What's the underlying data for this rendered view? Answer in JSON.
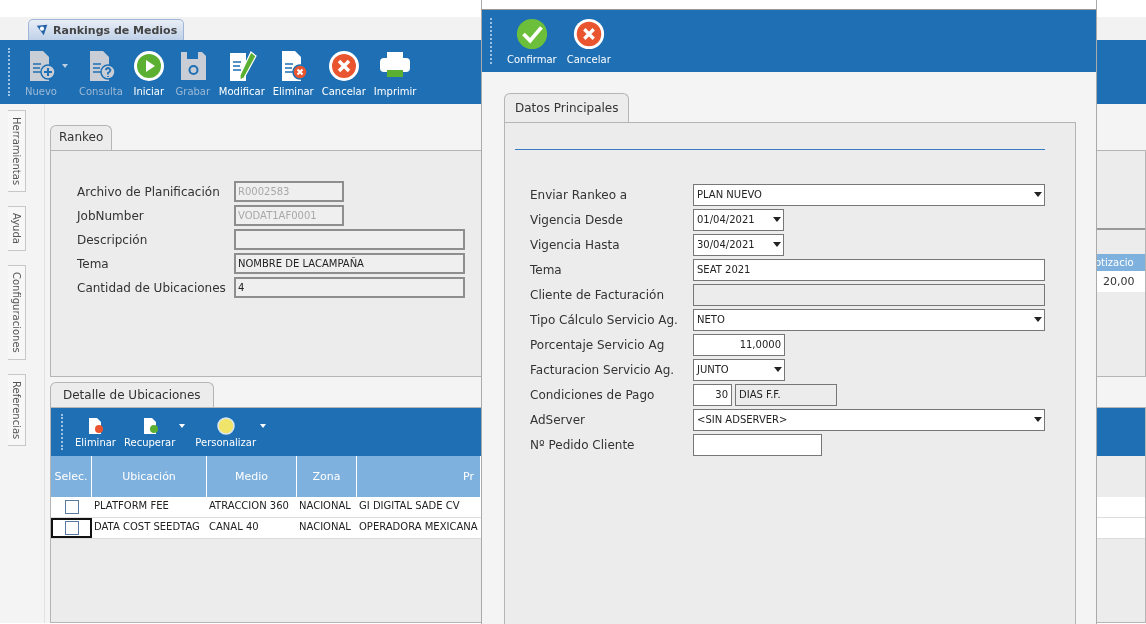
{
  "app_tab": {
    "title": "Rankings de Medios"
  },
  "toolbar": [
    {
      "label": "Nuevo",
      "kind": "add",
      "disabled": true,
      "dropdown": true
    },
    {
      "label": "Consulta",
      "kind": "query",
      "disabled": true,
      "dropdown": false
    },
    {
      "label": "Iniciar",
      "kind": "start",
      "disabled": false,
      "dropdown": false
    },
    {
      "label": "Grabar",
      "kind": "save",
      "disabled": true,
      "dropdown": false
    },
    {
      "label": "Modificar",
      "kind": "edit",
      "disabled": false,
      "dropdown": false
    },
    {
      "label": "Eliminar",
      "kind": "delete",
      "disabled": false,
      "dropdown": false
    },
    {
      "label": "Cancelar",
      "kind": "cancel",
      "disabled": false,
      "dropdown": false
    },
    {
      "label": "Imprimir",
      "kind": "print",
      "disabled": false,
      "dropdown": false
    }
  ],
  "side_tabs": [
    "Herramientas",
    "Ayuda",
    "Configuraciones",
    "Referencias"
  ],
  "rankeo": {
    "tab": "Rankeo",
    "fields": [
      {
        "label": "Archivo de Planificación",
        "value": "R0002583",
        "disabled": true,
        "kind": "short"
      },
      {
        "label": "JobNumber",
        "value": "VODAT1AF0001",
        "disabled": true,
        "kind": "short"
      },
      {
        "label": "Descripción",
        "kind": "long"
      },
      {
        "label": "Tema",
        "value": "NOMBRE DE LACAMPAÑA",
        "disabled": false,
        "kind": "long"
      },
      {
        "label": "Cantidad de Ubicaciones",
        "value": "4",
        "disabled": false,
        "kind": "long"
      }
    ]
  },
  "side_table": {
    "column": "otizacio",
    "cell": "20,00"
  },
  "detalle": {
    "tab": "Detalle de Ubicaciones",
    "toolbar": [
      {
        "label": "Eliminar",
        "kind": "delete",
        "dropdown": false
      },
      {
        "label": "Recuperar",
        "kind": "restore",
        "dropdown": true
      },
      {
        "label": "Personalizar",
        "kind": "custom",
        "dropdown": true
      }
    ],
    "select_column": "Selec.",
    "columns": [
      "Ubicación",
      "Medio",
      "Zona",
      "Pr"
    ],
    "rows": [
      {
        "checked": false,
        "selected": false,
        "cells": [
          "PLATFORM FEE",
          "ATRACCION 360",
          "NACIONAL",
          "GI DIGITAL SADE CV"
        ]
      },
      {
        "checked": false,
        "selected": true,
        "cells": [
          "DATA COST SEEDTAG",
          "CANAL 40",
          "NACIONAL",
          "OPERADORA MEXICANA"
        ]
      }
    ]
  },
  "dialog": {
    "toolbar": [
      {
        "label": "Confirmar",
        "kind": "confirm"
      },
      {
        "label": "Cancelar",
        "kind": "cancel"
      }
    ],
    "tab": "Datos Principales",
    "fields": [
      {
        "label": "Enviar Rankeo a",
        "value": "PLAN NUEVO",
        "kind": "dropdown"
      },
      {
        "label": "Vigencia Desde",
        "value": "01/04/2021",
        "kind": "date"
      },
      {
        "label": "Vigencia Hasta",
        "value": "30/04/2021",
        "kind": "date"
      },
      {
        "label": "Tema",
        "value": "SEAT 2021",
        "kind": "text"
      },
      {
        "label": "Cliente de Facturación",
        "kind": "readonly"
      },
      {
        "label": "Tipo Cálculo Servicio Ag.",
        "value": "NETO",
        "kind": "dropdown"
      },
      {
        "label": "Porcentaje Servicio Ag",
        "value": "11,0000",
        "kind": "number"
      },
      {
        "label": "Facturacion Servicio Ag.",
        "value": "JUNTO",
        "kind": "combo"
      },
      {
        "label": "Condiciones de Pago",
        "value": "30",
        "unit": "DIAS F.F.",
        "kind": "payment"
      },
      {
        "label": "AdServer",
        "value": "<SIN ADSERVER>",
        "kind": "dropdown"
      },
      {
        "label": "Nº Pedido Cliente",
        "kind": "entry"
      }
    ]
  }
}
